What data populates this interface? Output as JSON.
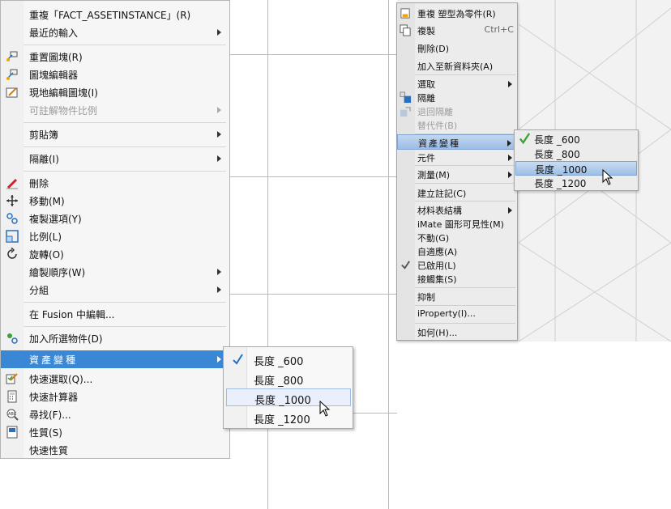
{
  "left_menu": {
    "items": [
      {
        "name": "repeat-fact-assetinstance",
        "label": "重複「FACT_ASSETINSTANCE」(R)",
        "icon": "",
        "submenu": false,
        "disabled": false
      },
      {
        "name": "recent-input",
        "label": "最近的輸入",
        "icon": "",
        "submenu": true,
        "disabled": false
      },
      {
        "name": "reset-block",
        "label": "重置圖塊(R)",
        "icon": "block-reset-icon",
        "submenu": false,
        "disabled": false
      },
      {
        "name": "block-editor",
        "label": "圖塊編輯器",
        "icon": "block-editor-icon",
        "submenu": false,
        "disabled": false
      },
      {
        "name": "edit-block-in-place",
        "label": "現地編輯圖塊(I)",
        "icon": "edit-in-place-icon",
        "submenu": false,
        "disabled": false
      },
      {
        "name": "annotative-object-scale",
        "label": "可註解物件比例",
        "icon": "",
        "submenu": true,
        "disabled": true
      },
      {
        "name": "clipboard",
        "label": "剪貼簿",
        "icon": "",
        "submenu": true,
        "disabled": false
      },
      {
        "name": "isolate",
        "label": "隔離(I)",
        "icon": "",
        "submenu": true,
        "disabled": false
      },
      {
        "name": "erase",
        "label": "刪除",
        "icon": "eraser-icon",
        "submenu": false,
        "disabled": false
      },
      {
        "name": "move",
        "label": "移動(M)",
        "icon": "move-icon",
        "submenu": false,
        "disabled": false
      },
      {
        "name": "copy-selection",
        "label": "複製選項(Y)",
        "icon": "copy-selection-icon",
        "submenu": false,
        "disabled": false
      },
      {
        "name": "scale",
        "label": "比例(L)",
        "icon": "scale-icon",
        "submenu": false,
        "disabled": false
      },
      {
        "name": "rotate",
        "label": "旋轉(O)",
        "icon": "rotate-icon",
        "submenu": false,
        "disabled": false
      },
      {
        "name": "draw-order",
        "label": "繪製順序(W)",
        "icon": "",
        "submenu": true,
        "disabled": false
      },
      {
        "name": "group",
        "label": "分組",
        "icon": "",
        "submenu": true,
        "disabled": false
      },
      {
        "name": "edit-in-fusion",
        "label": "在 Fusion 中編輯...",
        "icon": "",
        "submenu": false,
        "disabled": false
      },
      {
        "name": "add-selected",
        "label": "加入所選物件(D)",
        "icon": "add-selected-icon",
        "submenu": false,
        "disabled": false
      },
      {
        "name": "asset-variant",
        "label": "資產變種",
        "icon": "",
        "submenu": true,
        "disabled": false
      },
      {
        "name": "quick-select",
        "label": "快速選取(Q)...",
        "icon": "quick-select-icon",
        "submenu": false,
        "disabled": false
      },
      {
        "name": "quickcalc",
        "label": "快速計算器",
        "icon": "calculator-icon",
        "submenu": false,
        "disabled": false
      },
      {
        "name": "find",
        "label": "尋找(F)...",
        "icon": "find-text-icon",
        "submenu": false,
        "disabled": false
      },
      {
        "name": "properties",
        "label": "性質(S)",
        "icon": "properties-icon",
        "submenu": false,
        "disabled": false
      },
      {
        "name": "quick-properties",
        "label": "快速性質",
        "icon": "",
        "submenu": false,
        "disabled": false
      }
    ],
    "submenu": {
      "items": [
        "長度 _600",
        "長度 _800",
        "長度 _1000",
        "長度 _1200"
      ],
      "checked_index": 0,
      "hover_index": 2
    }
  },
  "right_menu": {
    "items": [
      {
        "name": "replace-proxy",
        "label": "重複 塑型為零件(R)",
        "icon": "part-icon",
        "submenu": false,
        "disabled": false,
        "shortcut": ""
      },
      {
        "name": "copy",
        "label": "複製",
        "icon": "copy-icon",
        "submenu": false,
        "disabled": false,
        "shortcut": "Ctrl+C"
      },
      {
        "name": "delete",
        "label": "刪除(D)",
        "icon": "",
        "submenu": false,
        "disabled": false,
        "shortcut": ""
      },
      {
        "name": "add-to-new-folder",
        "label": "加入至新資料夾(A)",
        "icon": "",
        "submenu": false,
        "disabled": false,
        "shortcut": ""
      },
      {
        "name": "select",
        "label": "選取",
        "icon": "",
        "submenu": true,
        "disabled": false,
        "shortcut": ""
      },
      {
        "name": "isolate",
        "label": "隔離",
        "icon": "isolate-icon",
        "submenu": false,
        "disabled": false,
        "shortcut": ""
      },
      {
        "name": "undo-isolate",
        "label": "退回隔離",
        "icon": "undo-isolate-icon",
        "submenu": false,
        "disabled": true,
        "shortcut": ""
      },
      {
        "name": "substitute",
        "label": "替代件(B)",
        "icon": "",
        "submenu": false,
        "disabled": true,
        "shortcut": ""
      },
      {
        "name": "asset-variant",
        "label": "資產變種",
        "icon": "",
        "submenu": true,
        "disabled": false,
        "shortcut": ""
      },
      {
        "name": "component",
        "label": "元件",
        "icon": "",
        "submenu": true,
        "disabled": false,
        "shortcut": ""
      },
      {
        "name": "measure",
        "label": "測量(M)",
        "icon": "",
        "submenu": true,
        "disabled": false,
        "shortcut": ""
      },
      {
        "name": "create-note",
        "label": "建立註記(C)",
        "icon": "",
        "submenu": false,
        "disabled": false,
        "shortcut": ""
      },
      {
        "name": "bom",
        "label": "材料表結構",
        "icon": "",
        "submenu": true,
        "disabled": false,
        "shortcut": ""
      },
      {
        "name": "imate-visibility",
        "label": "iMate 圖形可見性(M)",
        "icon": "",
        "submenu": false,
        "disabled": false,
        "shortcut": ""
      },
      {
        "name": "grounded",
        "label": "不動(G)",
        "icon": "",
        "submenu": false,
        "disabled": false,
        "shortcut": ""
      },
      {
        "name": "adaptive",
        "label": "自適應(A)",
        "icon": "",
        "submenu": false,
        "disabled": false,
        "shortcut": ""
      },
      {
        "name": "enabled",
        "label": "已啟用(L)",
        "icon": "check-icon",
        "submenu": false,
        "disabled": false,
        "shortcut": ""
      },
      {
        "name": "contact-set",
        "label": "接觸集(S)",
        "icon": "",
        "submenu": false,
        "disabled": false,
        "shortcut": ""
      },
      {
        "name": "suppress",
        "label": "抑制",
        "icon": "",
        "submenu": false,
        "disabled": false,
        "shortcut": ""
      },
      {
        "name": "iproperty",
        "label": "iProperty(I)...",
        "icon": "",
        "submenu": false,
        "disabled": false,
        "shortcut": ""
      },
      {
        "name": "how-to",
        "label": "如何(H)...",
        "icon": "",
        "submenu": false,
        "disabled": false,
        "shortcut": ""
      }
    ],
    "submenu": {
      "items": [
        "長度 _600",
        "長度 _800",
        "長度 _1000",
        "長度 _1200"
      ],
      "checked_index": 0,
      "hover_index": 2
    }
  },
  "colors": {
    "highlight": "#3a87d6",
    "check_green": "#3aa33a"
  }
}
